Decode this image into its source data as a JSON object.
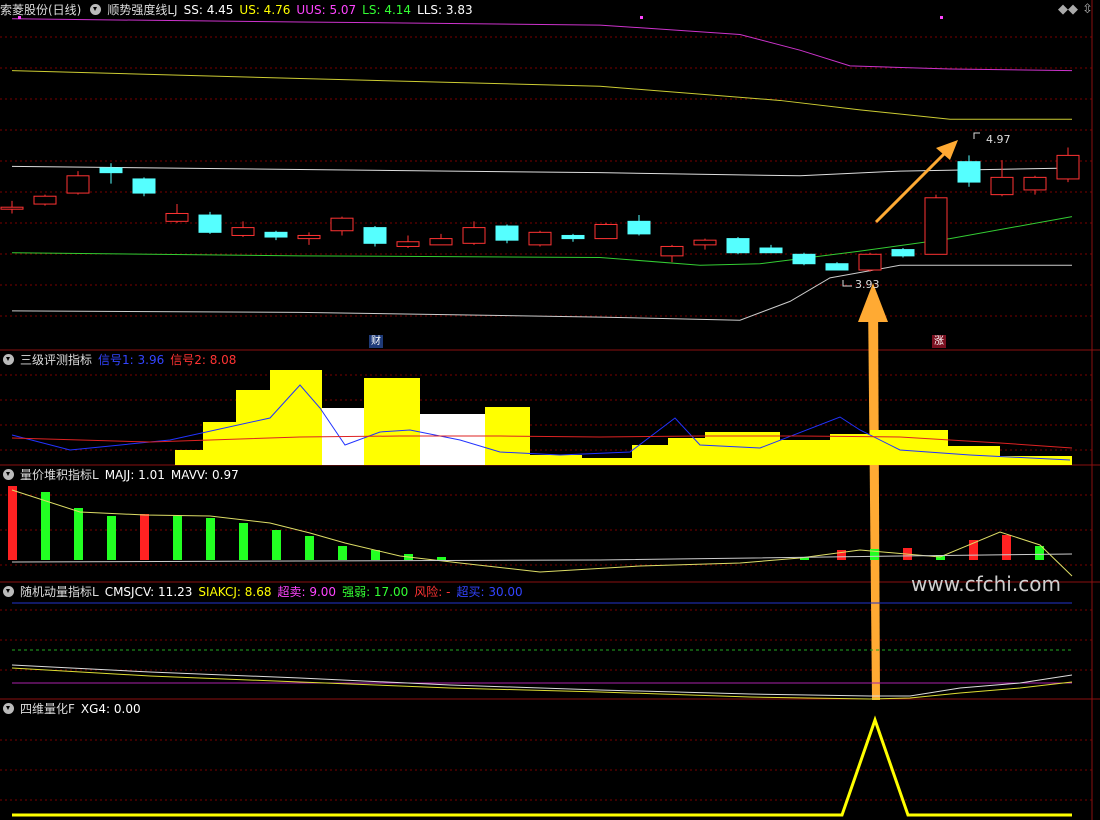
{
  "panels": {
    "main": {
      "title": "索菱股份(日线)",
      "indicator": "顺势强度线LJ",
      "values": [
        {
          "label": "SS: 4.45",
          "color": "#ffffff"
        },
        {
          "label": "US: 4.76",
          "color": "#ffff00"
        },
        {
          "label": "UUS: 5.07",
          "color": "#ff44ff"
        },
        {
          "label": "LS: 4.14",
          "color": "#33ff33"
        },
        {
          "label": "LLS: 3.83",
          "color": "#ffffff"
        }
      ],
      "high_label": "4.97",
      "low_label": "3.93",
      "badge_cai": "财",
      "badge_zhang": "涨"
    },
    "p2": {
      "indicator": "三级评测指标",
      "values": [
        {
          "label": "信号1: 3.96",
          "color": "#3344ff"
        },
        {
          "label": "信号2: 8.08",
          "color": "#ff3333"
        }
      ]
    },
    "p3": {
      "indicator": "量价堆积指标L",
      "values": [
        {
          "label": "MAJJ: 1.01",
          "color": "#ffffff"
        },
        {
          "label": "MAVV: 0.97",
          "color": "#ffffff"
        }
      ]
    },
    "p4": {
      "indicator": "随机动量指标L",
      "values": [
        {
          "label": "CMSJCV: 11.23",
          "color": "#ffffff"
        },
        {
          "label": "SIAKCJ: 8.68",
          "color": "#ffff00"
        },
        {
          "label": "超卖: 9.00",
          "color": "#ff44ff"
        },
        {
          "label": "强弱: 17.00",
          "color": "#33ff33"
        },
        {
          "label": "风险: -",
          "color": "#ff3333"
        },
        {
          "label": "超买: 30.00",
          "color": "#3344ff"
        }
      ]
    },
    "p5": {
      "indicator": "四维量化F",
      "values": [
        {
          "label": "XG4: 0.00",
          "color": "#ffffff"
        }
      ]
    }
  },
  "watermark": "www.cfchi.com",
  "window_controls": {
    "dots": "◆◆",
    "scroll": "⇳"
  },
  "colors": {
    "up": "#ff3333",
    "down": "#55ffff",
    "grid": "#7a0000",
    "arrow": "#ffaa33"
  },
  "chart_data": {
    "type": "candlestick",
    "candles": [
      {
        "o": 4.2,
        "c": 4.2,
        "h": 4.24,
        "l": 4.16
      },
      {
        "o": 4.22,
        "c": 4.27,
        "h": 4.28,
        "l": 4.21
      },
      {
        "o": 4.29,
        "c": 4.4,
        "h": 4.43,
        "l": 4.28
      },
      {
        "o": 4.45,
        "c": 4.42,
        "h": 4.48,
        "l": 4.35
      },
      {
        "o": 4.38,
        "c": 4.29,
        "h": 4.39,
        "l": 4.27
      },
      {
        "o": 4.11,
        "c": 4.16,
        "h": 4.22,
        "l": 4.1
      },
      {
        "o": 4.15,
        "c": 4.04,
        "h": 4.17,
        "l": 4.03
      },
      {
        "o": 4.02,
        "c": 4.07,
        "h": 4.11,
        "l": 4.01
      },
      {
        "o": 4.04,
        "c": 4.01,
        "h": 4.05,
        "l": 3.99
      },
      {
        "o": 4.0,
        "c": 4.02,
        "h": 4.04,
        "l": 3.96
      },
      {
        "o": 4.05,
        "c": 4.13,
        "h": 4.14,
        "l": 4.02
      },
      {
        "o": 4.07,
        "c": 3.97,
        "h": 4.08,
        "l": 3.95
      },
      {
        "o": 3.95,
        "c": 3.98,
        "h": 4.02,
        "l": 3.94
      },
      {
        "o": 3.96,
        "c": 4.0,
        "h": 4.03,
        "l": 3.96
      },
      {
        "o": 3.97,
        "c": 4.07,
        "h": 4.11,
        "l": 3.96
      },
      {
        "o": 4.08,
        "c": 3.99,
        "h": 4.09,
        "l": 3.97
      },
      {
        "o": 3.96,
        "c": 4.04,
        "h": 4.05,
        "l": 3.95
      },
      {
        "o": 4.02,
        "c": 4.0,
        "h": 4.03,
        "l": 3.98
      },
      {
        "o": 4.0,
        "c": 4.09,
        "h": 4.1,
        "l": 4.0
      },
      {
        "o": 4.11,
        "c": 4.03,
        "h": 4.15,
        "l": 4.02
      },
      {
        "o": 3.89,
        "c": 3.95,
        "h": 3.96,
        "l": 3.85
      },
      {
        "o": 3.96,
        "c": 3.99,
        "h": 4.0,
        "l": 3.93
      },
      {
        "o": 4.0,
        "c": 3.91,
        "h": 4.01,
        "l": 3.9
      },
      {
        "o": 3.94,
        "c": 3.91,
        "h": 3.96,
        "l": 3.91
      },
      {
        "o": 3.9,
        "c": 3.84,
        "h": 3.91,
        "l": 3.83
      },
      {
        "o": 3.84,
        "c": 3.8,
        "h": 3.85,
        "l": 3.8
      },
      {
        "o": 3.8,
        "c": 3.9,
        "h": 3.91,
        "l": 3.79
      },
      {
        "o": 3.93,
        "c": 3.89,
        "h": 3.94,
        "l": 3.88
      },
      {
        "o": 3.9,
        "c": 4.26,
        "h": 4.28,
        "l": 3.9
      },
      {
        "o": 4.49,
        "c": 4.36,
        "h": 4.53,
        "l": 4.33
      },
      {
        "o": 4.28,
        "c": 4.39,
        "h": 4.5,
        "l": 4.27
      },
      {
        "o": 4.31,
        "c": 4.39,
        "h": 4.4,
        "l": 4.28
      },
      {
        "o": 4.38,
        "c": 4.53,
        "h": 4.58,
        "l": 4.36
      }
    ]
  }
}
